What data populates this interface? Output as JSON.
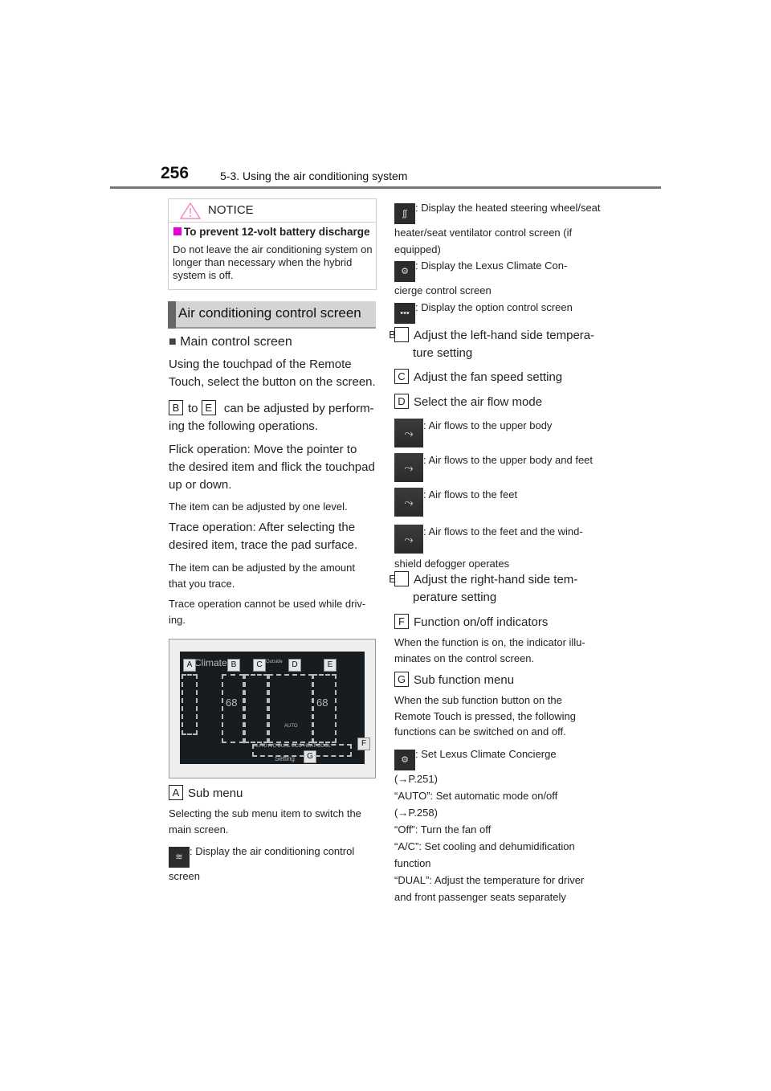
{
  "header": {
    "page_number": "256",
    "section": "5-3. Using the air conditioning system"
  },
  "notice": {
    "label": "NOTICE",
    "title": "To prevent 12-volt battery discharge",
    "body": "Do not leave the air conditioning system on longer than necessary when the hybrid system is off."
  },
  "section_title": "Air conditioning control screen",
  "left": {
    "subheading": "Main control screen",
    "p1": "Using the touchpad of the Remote Touch, select the button on the screen.",
    "p2_from": "B",
    "p2_to_word": "to",
    "p2_to": "E",
    "p2_rest": "can be adjusted by perform-",
    "p2_rest2": "ing the following operations.",
    "p3": "Flick operation: Move the pointer to the desired item and flick the touchpad up or down.",
    "p3_note": "The item can be adjusted by one level.",
    "p4": "Trace operation: After selecting the desired item, trace the pad surface.",
    "p4_note": "The item can be adjusted by the amount that you trace.",
    "p4_note2": "Trace operation cannot be used while driv-ing.",
    "itemA": {
      "label": "A",
      "title": "Sub menu",
      "desc": "Selecting the sub menu item to switch the main screen.",
      "icon_desc": ": Display the air conditioning control screen"
    }
  },
  "screen": {
    "tags": [
      "A",
      "B",
      "C",
      "D",
      "E",
      "F",
      "G"
    ],
    "climate": "Climate",
    "outside": "Outside",
    "temp_left": "68",
    "temp_right": "68",
    "mode": "AUTO",
    "buttons": [
      "AUTO",
      "A/C",
      "DUAL",
      "ECO HEAT/COOL"
    ],
    "setting": "Setting"
  },
  "right": {
    "icon1_desc": ": Display the heated steering wheel/seat heater/seat ventilator control screen (if equipped)",
    "icon2_desc": ": Display the Lexus Climate Con-cierge control screen",
    "icon3_desc": ": Display the option control screen",
    "items": [
      {
        "label": "B",
        "title": "Adjust the left-hand side tempera-ture setting"
      },
      {
        "label": "C",
        "title": "Adjust the fan speed setting"
      },
      {
        "label": "D",
        "title": "Select the air flow mode"
      }
    ],
    "flows": [
      ": Air flows to the upper body",
      ": Air flows to the upper body and feet",
      ": Air flows to the feet",
      ": Air flows to the feet and the wind-shield defogger operates"
    ],
    "itemE": {
      "label": "E",
      "title": "Adjust the right-hand side tem-perature setting"
    },
    "itemF": {
      "label": "F",
      "title": "Function on/off indicators",
      "desc": "When the function is on, the indicator illu-minates on the control screen."
    },
    "itemG": {
      "label": "G",
      "title": "Sub function menu",
      "desc": "When the sub function button on the Remote Touch is pressed, the following functions can be switched on and off.",
      "lines": [
        ": Set Lexus Climate Concierge",
        "(→P.251)",
        "“AUTO”: Set automatic mode on/off",
        "(→P.258)",
        "“Off”: Turn the fan off",
        "“A/C”: Set cooling and dehumidification function",
        "“DUAL”: Adjust the temperature for driver and front passenger seats separately"
      ]
    }
  }
}
